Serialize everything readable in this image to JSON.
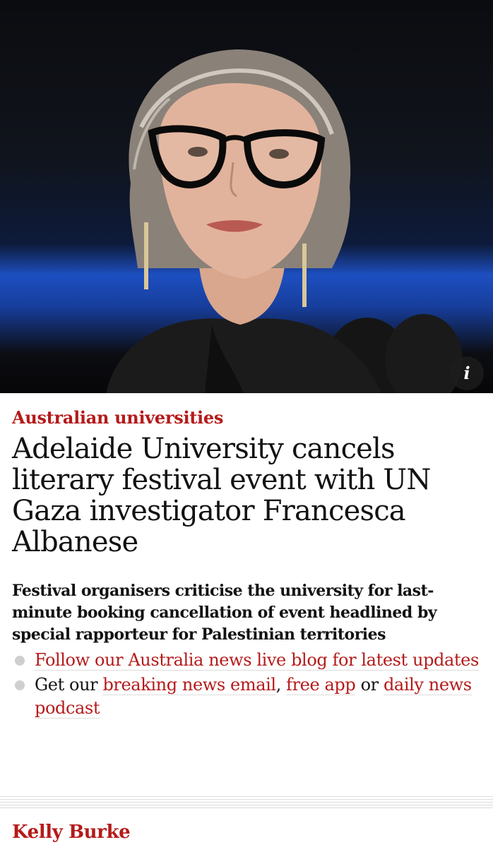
{
  "article": {
    "kicker": "Australian universities",
    "headline": "Adelaide University cancels literary festival event with UN Gaza investigator Francesca Albanese",
    "standfirst": "Festival organisers criticise the university for last-minute booking cancellation of event headlined by special rapporteur for Palestinian territories",
    "bullets": [
      {
        "link": "Follow our Australia news live blog for latest updates"
      },
      {
        "prefix": "Get our ",
        "link1": "breaking news email",
        "sep1": ", ",
        "link2": "free app",
        "sep2": " or ",
        "link3": "daily news podcast"
      }
    ],
    "byline": "Kelly Burke"
  },
  "hero": {
    "info_button_label": "i",
    "info_icon": "info-icon"
  },
  "colors": {
    "accent": "#b51a1a",
    "text": "#121212",
    "rule": "#dcdcdc"
  }
}
